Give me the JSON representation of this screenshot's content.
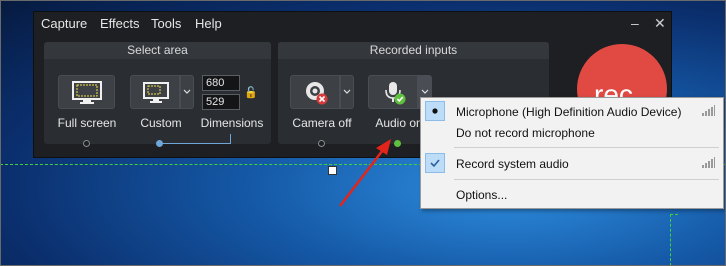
{
  "menu_bar": {
    "capture": "Capture",
    "effects": "Effects",
    "tools": "Tools",
    "help": "Help",
    "minimize": "–",
    "close": "✕"
  },
  "select_area": {
    "title": "Select area",
    "full_screen_label": "Full screen",
    "custom_label": "Custom",
    "dimensions_label": "Dimensions",
    "width": "680",
    "height": "529"
  },
  "recorded_inputs": {
    "title": "Recorded inputs",
    "camera_label": "Camera off",
    "audio_label": "Audio on"
  },
  "record_button": {
    "label": "rec",
    "color": "#e04a43"
  },
  "audio_menu": {
    "items": [
      {
        "label": "Microphone (High Definition Audio Device)",
        "state": "selected-radio"
      },
      {
        "label": "Do not record microphone",
        "state": "none"
      },
      {
        "label": "Record system audio",
        "state": "checked"
      },
      {
        "label": "Options...",
        "state": "none"
      }
    ]
  },
  "colors": {
    "accent_blue": "#6ea6d8",
    "active_green": "#5fbf3f",
    "arrow_red": "#e3241b",
    "guide_green": "#3fd23f"
  }
}
